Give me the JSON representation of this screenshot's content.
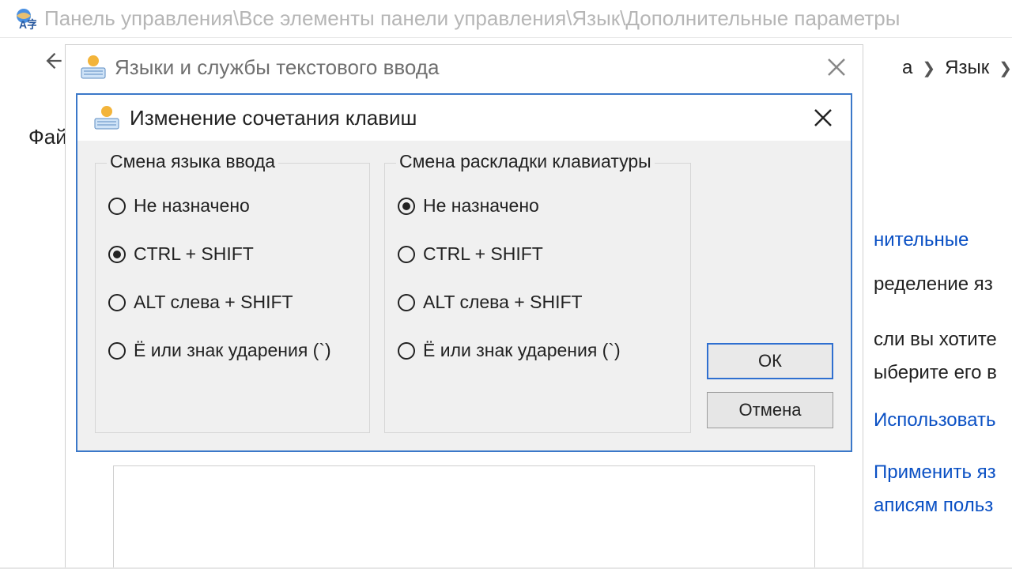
{
  "topbar": {
    "path": "Панель управления\\Все элементы панели управления\\Язык\\Дополнительные параметры"
  },
  "explorer": {
    "file_menu": "Файл",
    "crumb_a_prefix": "а",
    "crumb_lang": "Язык"
  },
  "bg_right": {
    "l1": "нительные",
    "l2": "ределение яз",
    "l3": "сли вы хотите",
    "l4": "ыберите его в",
    "l5": "Использовать",
    "l6": "Применить яз",
    "l7": "аписям польз"
  },
  "outer_dialog": {
    "title": "Языки и службы текстового ввода"
  },
  "inner_dialog": {
    "title": "Изменение сочетания клавиш",
    "group_left": {
      "legend": "Смена языка ввода",
      "options": [
        "Не назначено",
        "CTRL + SHIFT",
        "ALT слева + SHIFT",
        "Ё или знак ударения (`)"
      ],
      "selected_index": 1
    },
    "group_right": {
      "legend": "Смена раскладки клавиатуры",
      "options": [
        "Не назначено",
        "CTRL + SHIFT",
        "ALT слева + SHIFT",
        "Ё или знак ударения (`)"
      ],
      "selected_index": 0
    },
    "ok": "ОК",
    "cancel": "Отмена"
  }
}
